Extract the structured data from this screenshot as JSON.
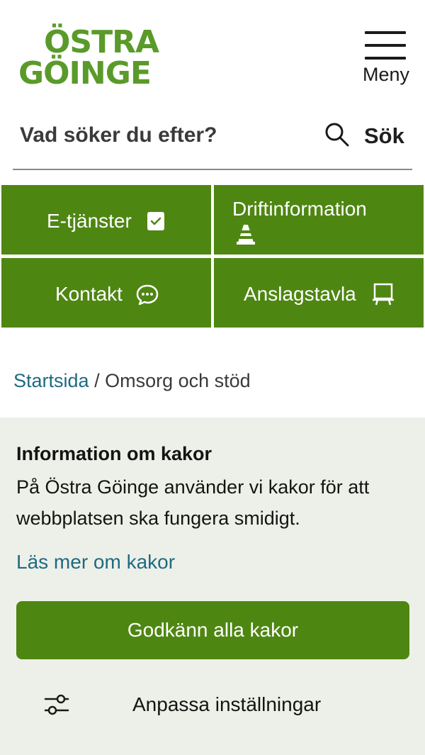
{
  "brand": {
    "logo_line1": "ÖSTRA",
    "logo_line2": "GÖINGE",
    "color": "#5a9a2a"
  },
  "header": {
    "menu_label": "Meny",
    "menu_icon": "hamburger-icon"
  },
  "search": {
    "placeholder": "Vad söker du efter?",
    "button_label": "Sök",
    "icon": "search-icon"
  },
  "quick_links": [
    {
      "label": "E-tjänster",
      "icon": "checkbox-icon"
    },
    {
      "label": "Driftinformation",
      "icon": "traffic-cone-icon"
    },
    {
      "label": "Kontakt",
      "icon": "chat-bubble-icon"
    },
    {
      "label": "Anslagstavla",
      "icon": "notice-board-icon"
    }
  ],
  "breadcrumb": {
    "home": "Startsida",
    "separator": "/",
    "current": "Omsorg och stöd"
  },
  "cookie_banner": {
    "title": "Information om kakor",
    "text": "På Östra Göinge använder vi kakor för att webbplatsen ska fungera smidigt.",
    "read_more": "Läs mer om kakor",
    "accept_label": "Godkänn alla kakor",
    "customize_label": "Anpassa inställningar",
    "customize_icon": "sliders-icon"
  },
  "colors": {
    "primary_green": "#4e8612",
    "link": "#1f6a82",
    "banner_bg": "#edf0e8"
  }
}
